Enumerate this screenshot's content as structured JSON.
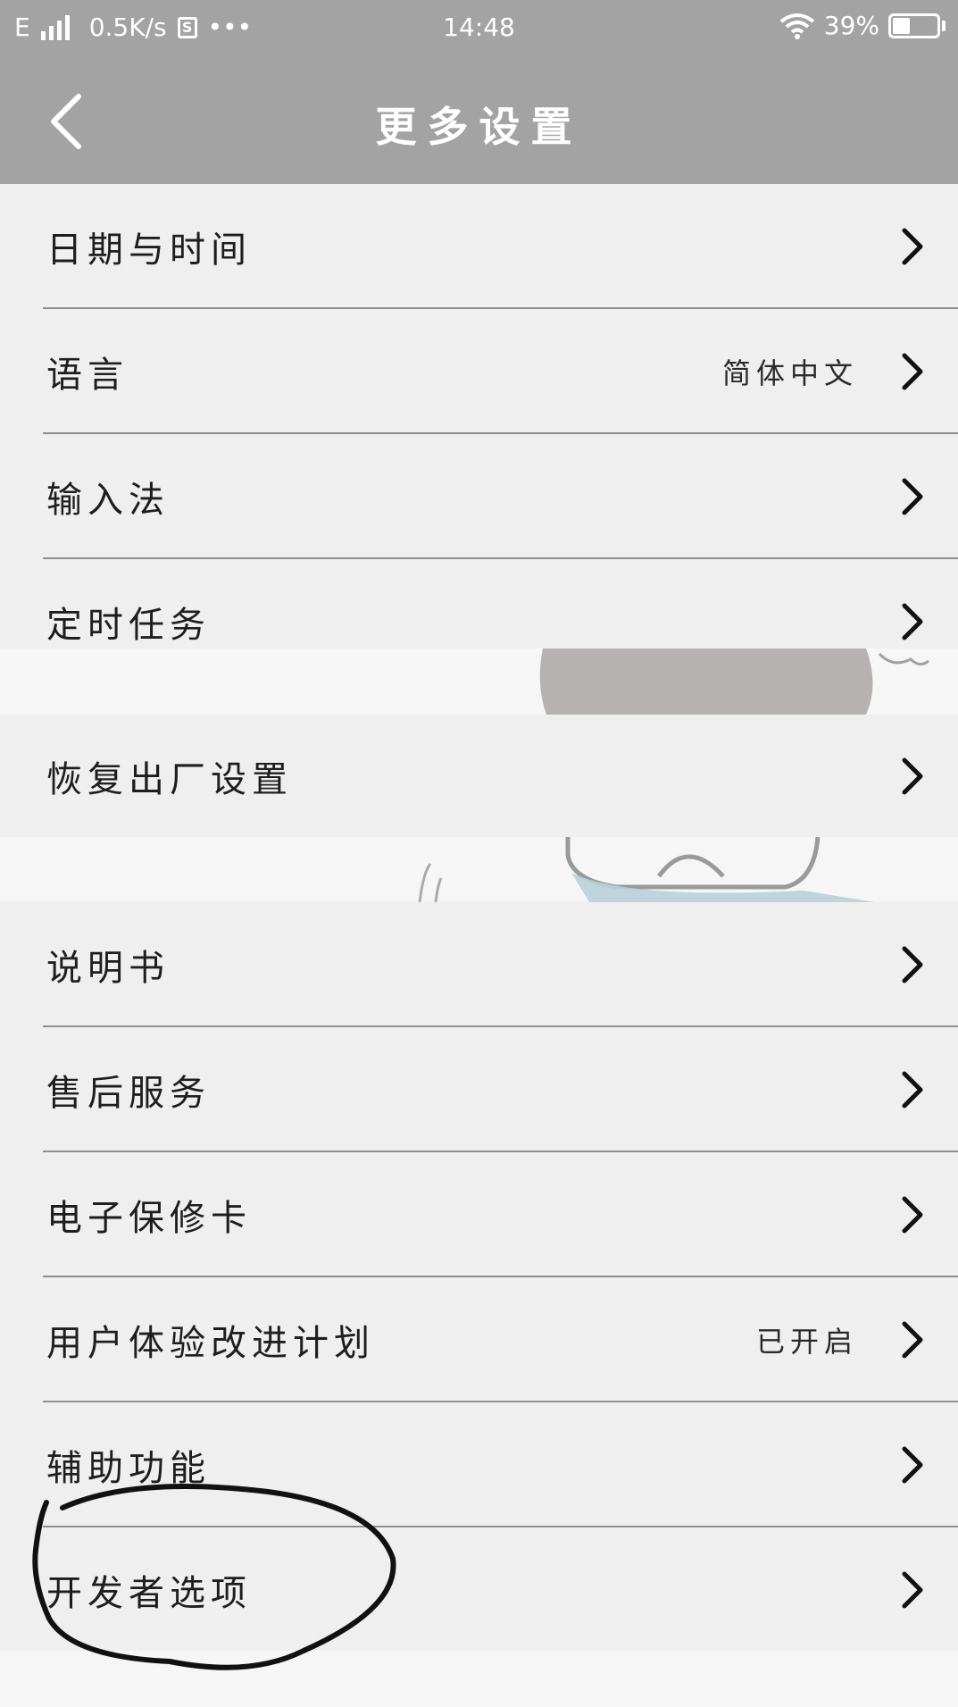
{
  "status_bar": {
    "network_type": "E",
    "speed": "0.5K/s",
    "notification_icon": "s-app-icon",
    "dots": "•••",
    "time": "14:48",
    "battery_percent": "39%",
    "battery_level": 0.39
  },
  "header": {
    "title": "更多设置",
    "back_icon": "back-arrow-icon"
  },
  "group1": [
    {
      "label": "日期与时间",
      "value": ""
    },
    {
      "label": "语言",
      "value": "简体中文"
    },
    {
      "label": "输入法",
      "value": ""
    },
    {
      "label": "定时任务",
      "value": ""
    }
  ],
  "group2": [
    {
      "label": "恢复出厂设置",
      "value": ""
    }
  ],
  "group3": [
    {
      "label": "说明书",
      "value": ""
    },
    {
      "label": "售后服务",
      "value": ""
    },
    {
      "label": "电子保修卡",
      "value": ""
    },
    {
      "label": "用户体验改进计划",
      "value": "已开启"
    },
    {
      "label": "辅助功能",
      "value": ""
    },
    {
      "label": "开发者选项",
      "value": ""
    }
  ]
}
